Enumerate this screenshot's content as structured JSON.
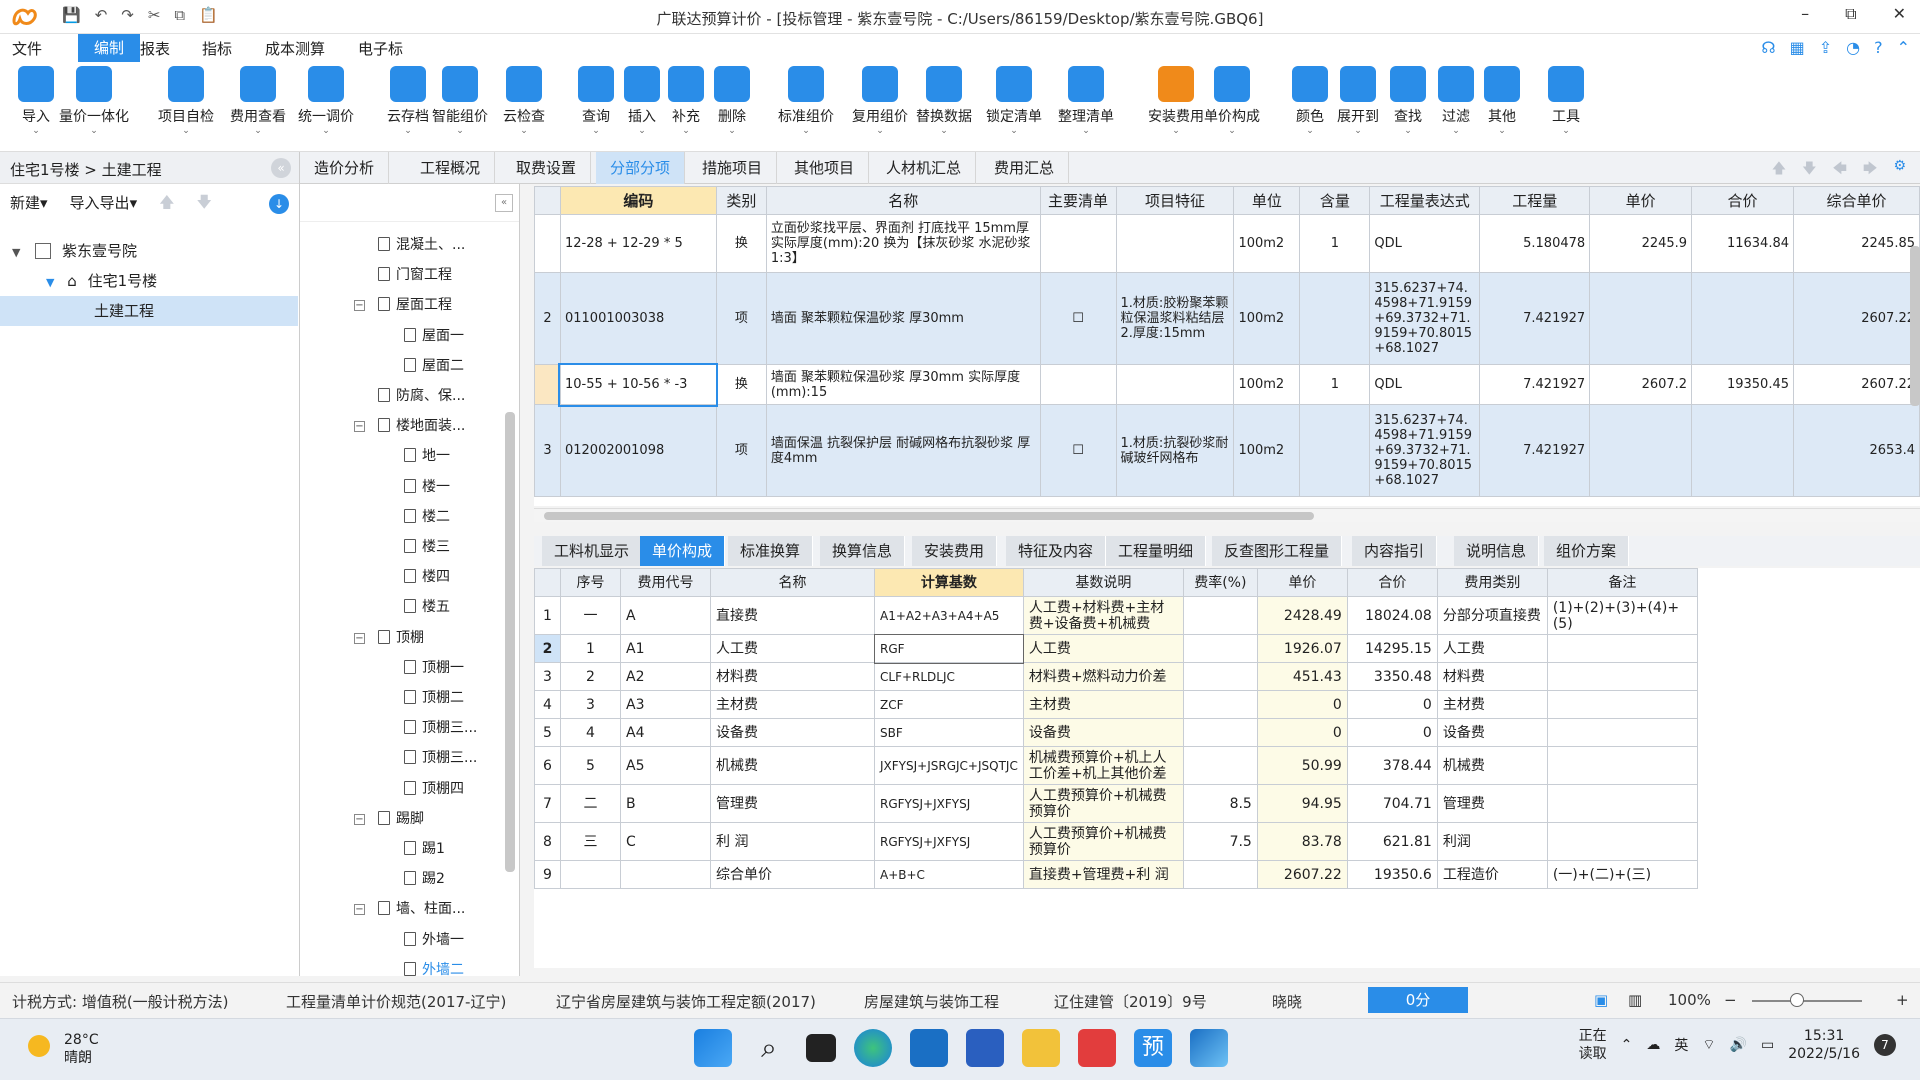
{
  "window": {
    "title": "广联达预算计价 - [投标管理 - 紫东壹号院 - C:/Users/86159/Desktop/紫东壹号院.GBQ6]",
    "minimize": "–",
    "restore": "⧉",
    "close": "✕"
  },
  "quick_access": {
    "save": "💾",
    "undo": "↶",
    "redo": "↷",
    "cut": "✂",
    "copy": "⧉",
    "paste": "📋"
  },
  "menu": {
    "items": [
      "文件",
      "编制",
      "报表",
      "指标",
      "成本测算",
      "电子标"
    ],
    "active": "编制"
  },
  "ribbon": {
    "tools": [
      {
        "label": "导入",
        "color": "#2a8de8"
      },
      {
        "label": "量价一体化",
        "color": "#2a8de8"
      },
      {
        "label": "项目自检",
        "color": "#2a8de8"
      },
      {
        "label": "费用查看",
        "color": "#2a8de8"
      },
      {
        "label": "统一调价",
        "color": "#2a8de8"
      },
      {
        "label": "云存档",
        "color": "#2a8de8"
      },
      {
        "label": "智能组价",
        "color": "#2a8de8"
      },
      {
        "label": "云检查",
        "color": "#2a8de8"
      },
      {
        "label": "查询",
        "color": "#2a8de8"
      },
      {
        "label": "插入",
        "color": "#2a8de8"
      },
      {
        "label": "补充",
        "color": "#2a8de8"
      },
      {
        "label": "删除",
        "color": "#2a8de8"
      },
      {
        "label": "标准组价",
        "color": "#2a8de8"
      },
      {
        "label": "复用组价",
        "color": "#2a8de8"
      },
      {
        "label": "替换数据",
        "color": "#2a8de8"
      },
      {
        "label": "锁定清单",
        "color": "#2a8de8"
      },
      {
        "label": "整理清单",
        "color": "#2a8de8"
      },
      {
        "label": "安装费用",
        "color": "#f08a1a"
      },
      {
        "label": "单价构成",
        "color": "#2a8de8"
      },
      {
        "label": "颜色",
        "color": "#2a8de8"
      },
      {
        "label": "展开到",
        "color": "#2a8de8"
      },
      {
        "label": "查找",
        "color": "#2a8de8"
      },
      {
        "label": "过滤",
        "color": "#2a8de8"
      },
      {
        "label": "其他",
        "color": "#2a8de8"
      },
      {
        "label": "工具",
        "color": "#2a8de8"
      }
    ]
  },
  "left": {
    "breadcrumb": "住宅1号楼 > 土建工程",
    "new": "新建",
    "importexport": "导入导出",
    "project": "紫东壹号院",
    "building": "住宅1号楼",
    "unit": "土建工程"
  },
  "midtree": {
    "items": [
      "混凝土、...",
      "门窗工程",
      "屋面工程",
      "屋面一",
      "屋面二",
      "防腐、保...",
      "楼地面装...",
      "地一",
      "楼一",
      "楼二",
      "楼三",
      "楼四",
      "楼五",
      "顶棚",
      "顶棚一",
      "顶棚二",
      "顶棚三...",
      "顶棚三...",
      "顶棚四",
      "踢脚",
      "踢1",
      "踢2",
      "墙、柱面...",
      "外墙一",
      "外墙二"
    ]
  },
  "tabs": [
    "造价分析",
    "工程概况",
    "取费设置",
    "分部分项",
    "措施项目",
    "其他项目",
    "人材机汇总",
    "费用汇总"
  ],
  "tabs_active": "分部分项",
  "grid": {
    "headers": [
      "",
      "编码",
      "类别",
      "名称",
      "主要清单",
      "项目特征",
      "单位",
      "含量",
      "工程量表达式",
      "工程量",
      "单价",
      "合价",
      "综合单价"
    ],
    "rows": [
      {
        "no": "",
        "code": "12-28 + 12-29 * 5",
        "type": "换",
        "name": "立面砂浆找平层、界面剂 打底找平 15mm厚 实际厚度(mm):20 换为【抹灰砂浆 水泥砂浆 1:3】",
        "main": "",
        "feature": "",
        "unit": "100m2",
        "content": "1",
        "expr": "QDL",
        "qty": "5.180478",
        "price": "2245.9",
        "total": "11634.84",
        "uprice": "2245.85"
      },
      {
        "no": "2",
        "code": "011001003038",
        "type": "项",
        "name": "墙面 聚苯颗粒保温砂浆 厚30mm",
        "main": "☐",
        "feature": "1.材质:胶粉聚苯颗粒保温浆料粘结层\n2.厚度:15mm",
        "unit": "100m2",
        "content": "",
        "expr": "315.6237+74.4598+71.9159+69.3732+71.9159+70.8015+68.1027",
        "qty": "7.421927",
        "price": "",
        "total": "",
        "uprice": "2607.22"
      },
      {
        "no": "",
        "code": "10-55 + 10-56 * -3",
        "type": "换",
        "name": "墙面 聚苯颗粒保温砂浆 厚30mm 实际厚度(mm):15",
        "main": "",
        "feature": "",
        "unit": "100m2",
        "content": "1",
        "expr": "QDL",
        "qty": "7.421927",
        "price": "2607.2",
        "total": "19350.45",
        "uprice": "2607.22"
      },
      {
        "no": "3",
        "code": "012002001098",
        "type": "项",
        "name": "墙面保温 抗裂保护层 耐碱网格布抗裂砂浆 厚度4mm",
        "main": "☐",
        "feature": "1.材质:抗裂砂浆耐碱玻纤网格布",
        "unit": "100m2",
        "content": "",
        "expr": "315.6237+74.4598+71.9159+69.3732+71.9159+70.8015+68.1027",
        "qty": "7.421927",
        "price": "",
        "total": "",
        "uprice": "2653.4"
      }
    ]
  },
  "btabs": [
    "工料机显示",
    "单价构成",
    "标准换算",
    "换算信息",
    "安装费用",
    "特征及内容",
    "工程量明细",
    "反查图形工程量",
    "内容指引",
    "说明信息",
    "组价方案"
  ],
  "btabs_active": "单价构成",
  "bgrid": {
    "headers": [
      "",
      "序号",
      "费用代号",
      "名称",
      "计算基数",
      "基数说明",
      "费率(%)",
      "单价",
      "合价",
      "费用类别",
      "备注"
    ],
    "rows": [
      [
        "1",
        "一",
        "A",
        "直接费",
        "A1+A2+A3+A4+A5",
        "人工费+材料费+主材费+设备费+机械费",
        "",
        "2428.49",
        "18024.08",
        "分部分项直接费",
        "(1)+(2)+(3)+(4)+(5)"
      ],
      [
        "2",
        "1",
        "A1",
        "人工费",
        "RGF",
        "人工费",
        "",
        "1926.07",
        "14295.15",
        "人工费",
        ""
      ],
      [
        "3",
        "2",
        "A2",
        "材料费",
        "CLF+RLDLJC",
        "材料费+燃料动力价差",
        "",
        "451.43",
        "3350.48",
        "材料费",
        ""
      ],
      [
        "4",
        "3",
        "A3",
        "主材费",
        "ZCF",
        "主材费",
        "",
        "0",
        "0",
        "主材费",
        ""
      ],
      [
        "5",
        "4",
        "A4",
        "设备费",
        "SBF",
        "设备费",
        "",
        "0",
        "0",
        "设备费",
        ""
      ],
      [
        "6",
        "5",
        "A5",
        "机械费",
        "JXFYSJ+JSRGJC+JSQTJC",
        "机械费预算价+机上人工价差+机上其他价差",
        "",
        "50.99",
        "378.44",
        "机械费",
        ""
      ],
      [
        "7",
        "二",
        "B",
        "管理费",
        "RGFYSJ+JXFYSJ",
        "人工费预算价+机械费预算价",
        "8.5",
        "94.95",
        "704.71",
        "管理费",
        ""
      ],
      [
        "8",
        "三",
        "C",
        "利  润",
        "RGFYSJ+JXFYSJ",
        "人工费预算价+机械费预算价",
        "7.5",
        "83.78",
        "621.81",
        "利润",
        ""
      ],
      [
        "9",
        "",
        "",
        "综合单价",
        "A+B+C",
        "直接费+管理费+利  润",
        "",
        "2607.22",
        "19350.6",
        "工程造价",
        "(一)+(二)+(三)"
      ]
    ]
  },
  "status": {
    "tax": "计税方式: 增值税(一般计税方法)",
    "spec": "工程量清单计价规范(2017-辽宁)",
    "quota": "辽宁省房屋建筑与装饰工程定额(2017)",
    "kind": "房屋建筑与装饰工程",
    "doc": "辽住建管〔2019〕9号",
    "user": "晓晓",
    "progress": "0分",
    "zoom": "100%"
  },
  "taskbar": {
    "temp": "28°C",
    "weather": "晴朗",
    "reading": "正在\n读取",
    "lang": "英",
    "time": "15:31",
    "date": "2022/5/16",
    "badge": "7"
  }
}
